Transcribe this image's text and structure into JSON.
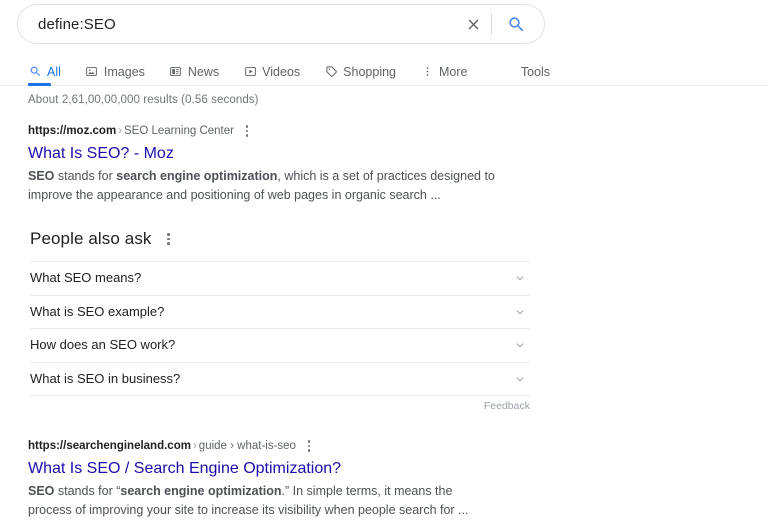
{
  "search": {
    "query": "define:SEO",
    "placeholder": "Search",
    "clear_label": "Clear",
    "search_label": "Google Search"
  },
  "nav": {
    "tabs": [
      {
        "label": "All",
        "icon": "search-icon",
        "active": true
      },
      {
        "label": "Images",
        "icon": "image-icon",
        "active": false
      },
      {
        "label": "News",
        "icon": "news-icon",
        "active": false
      },
      {
        "label": "Videos",
        "icon": "video-icon",
        "active": false
      },
      {
        "label": "Shopping",
        "icon": "tag-icon",
        "active": false
      },
      {
        "label": "More",
        "icon": "kebab-icon",
        "active": false
      }
    ],
    "tools_label": "Tools"
  },
  "results_stats": "About 2,61,00,00,000 results (0.56 seconds)",
  "results": [
    {
      "domain": "https://moz.com",
      "breadcrumb": "SEO Learning Center",
      "title": "What Is SEO? - Moz",
      "snippet_parts": [
        {
          "text": "SEO",
          "bold": true
        },
        {
          "text": " stands for ",
          "bold": false
        },
        {
          "text": "search engine optimization",
          "bold": true
        },
        {
          "text": ", which is a set of practices designed to improve the appearance and positioning of web pages in organic search ...",
          "bold": false
        }
      ]
    },
    {
      "domain": "https://searchengineland.com",
      "breadcrumb": "guide › what-is-seo",
      "title": "What Is SEO / Search Engine Optimization?",
      "snippet_parts": [
        {
          "text": "SEO",
          "bold": true
        },
        {
          "text": " stands for “",
          "bold": false
        },
        {
          "text": "search engine optimization",
          "bold": true
        },
        {
          "text": ".” In simple terms, it means the process of improving your site to increase its visibility when people search for ...",
          "bold": false
        }
      ]
    }
  ],
  "people_also_ask": {
    "title": "People also ask",
    "questions": [
      "What SEO means?",
      "What is SEO example?",
      "How does an SEO work?",
      "What is SEO in business?"
    ],
    "feedback_label": "Feedback"
  },
  "colors": {
    "link_blue": "#1a0dab",
    "accent_blue": "#1a73e8",
    "text_gray": "#5f6368",
    "snippet_gray": "#4d5156",
    "stats_gray": "#70757a"
  }
}
